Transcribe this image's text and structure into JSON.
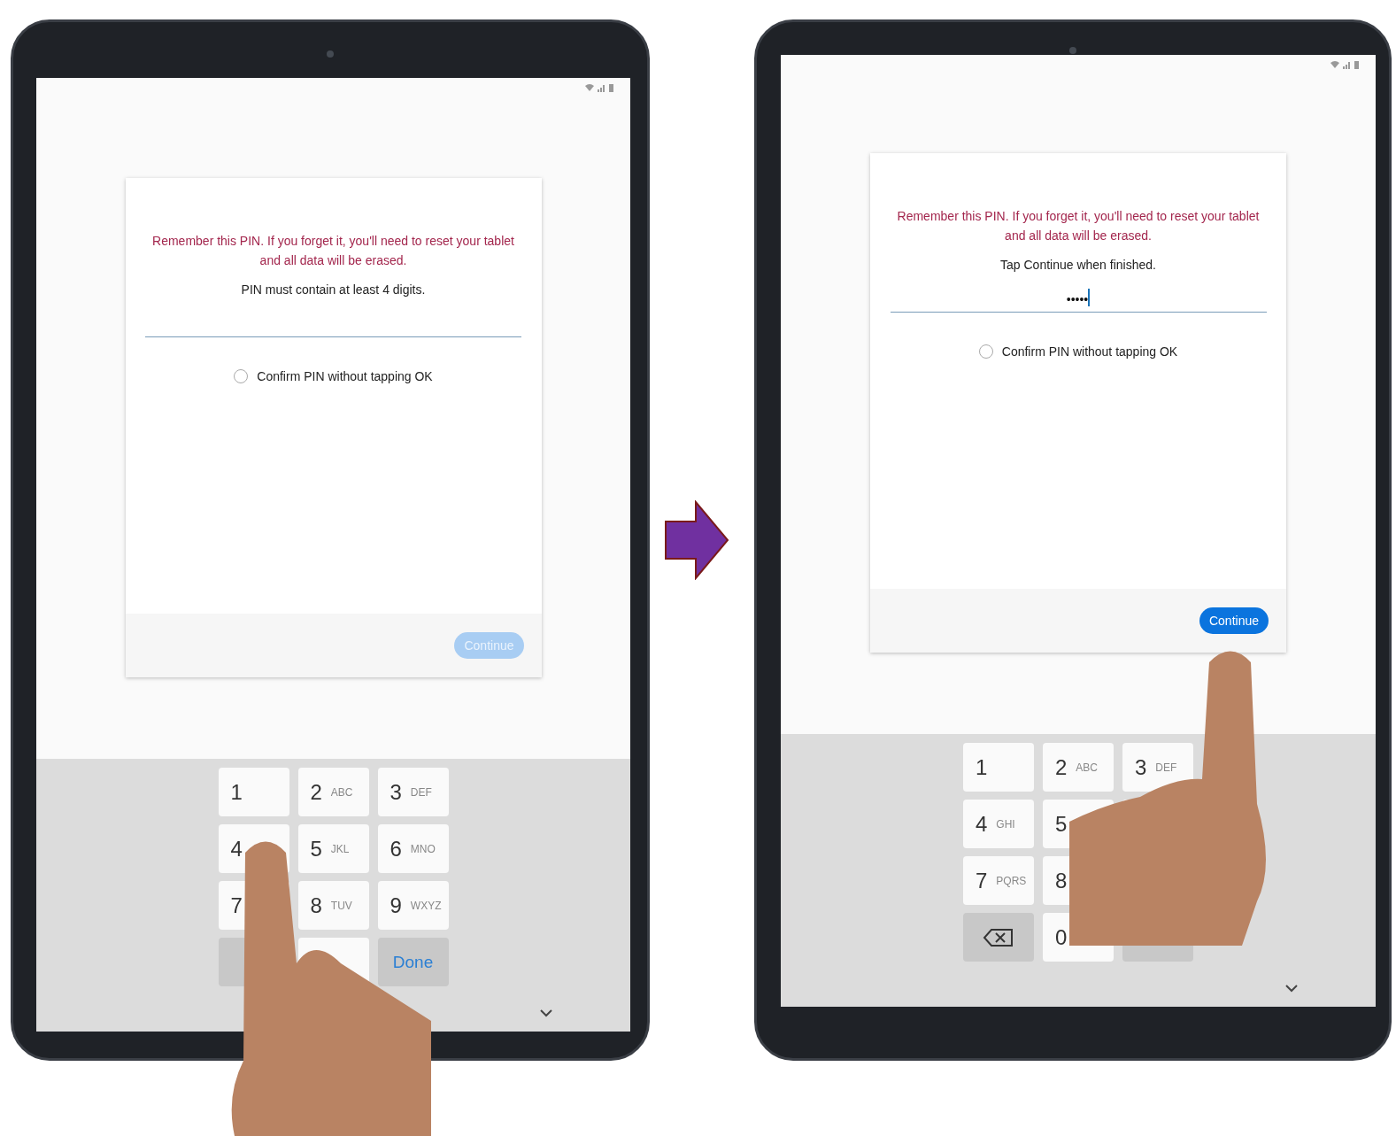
{
  "tablets": [
    {
      "card": {
        "warning": "Remember this PIN. If you forget it, you'll need to reset your tablet and all data will be erased.",
        "instruction": "PIN must contain at least 4 digits.",
        "pin_field": {
          "focused": false
        },
        "checkbox": {
          "label": "Confirm PIN without tapping OK",
          "checked": false
        },
        "continue_button": {
          "label": "Continue",
          "disabled": true
        }
      },
      "keys": [
        {
          "kind": "digit",
          "digit": "1"
        },
        {
          "kind": "digit",
          "digit": "2",
          "letters": "ABC"
        },
        {
          "kind": "digit",
          "digit": "3",
          "letters": "DEF"
        },
        {
          "kind": "digit",
          "digit": "4"
        },
        {
          "kind": "digit",
          "digit": "5",
          "letters": "JKL"
        },
        {
          "kind": "digit",
          "digit": "6",
          "letters": "MNO"
        },
        {
          "kind": "digit",
          "digit": "7"
        },
        {
          "kind": "digit",
          "digit": "8",
          "letters": "TUV"
        },
        {
          "kind": "digit",
          "digit": "9",
          "letters": "WXYZ"
        },
        {
          "kind": "action_blank"
        },
        {
          "kind": "blank"
        },
        {
          "kind": "done",
          "label": "Done"
        }
      ]
    },
    {
      "card": {
        "warning": "Remember this PIN. If you forget it, you'll need to reset your tablet and all data will be erased.",
        "instruction": "Tap Continue when finished.",
        "pin_field": {
          "value": "•••••",
          "focused": true
        },
        "checkbox": {
          "label": "Confirm PIN without tapping OK",
          "checked": false
        },
        "continue_button": {
          "label": "Continue",
          "disabled": false
        }
      },
      "keys": [
        {
          "kind": "digit",
          "digit": "1"
        },
        {
          "kind": "digit",
          "digit": "2",
          "letters": "ABC"
        },
        {
          "kind": "digit",
          "digit": "3",
          "letters": "DEF"
        },
        {
          "kind": "digit",
          "digit": "4",
          "letters": "GHI"
        },
        {
          "kind": "digit",
          "digit": "5"
        },
        {
          "kind": "blank"
        },
        {
          "kind": "digit",
          "digit": "7",
          "letters": "PQRS"
        },
        {
          "kind": "digit",
          "digit": "8"
        },
        {
          "kind": "blank"
        },
        {
          "kind": "backspace"
        },
        {
          "kind": "digit",
          "digit": "0"
        },
        {
          "kind": "action_blank"
        }
      ]
    }
  ]
}
